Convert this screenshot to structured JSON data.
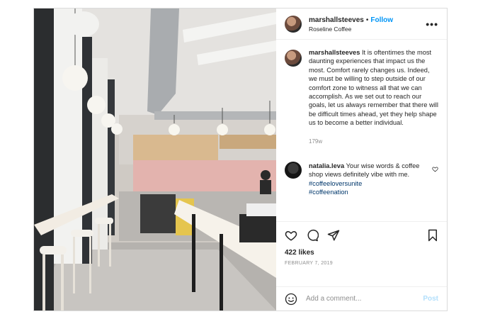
{
  "header": {
    "username": "marshallsteeves",
    "separator": "•",
    "follow_label": "Follow",
    "location": "Roseline Coffee",
    "more_icon": "more-horizontal-icon"
  },
  "caption": {
    "username": "marshallsteeves",
    "text": "It is oftentimes the most daunting experiences that impact us the most. Comfort rarely changes us. Indeed, we must be willing to step outside of our comfort zone to witness all that we can accomplish. As we set out to reach our goals, let us always remember that there will be difficult times ahead, yet they help shape us to become a better individual.",
    "time": "179w"
  },
  "comments": [
    {
      "username": "natalia.leva",
      "text": "Your wise words & coffee shop views definitely vibe with me.",
      "tags": [
        "#coffeeloversunite",
        "#coffeenation"
      ]
    }
  ],
  "actions": {
    "likes": "422 likes",
    "date": "FEBRUARY 7, 2019"
  },
  "add_comment": {
    "placeholder": "Add a comment...",
    "post_label": "Post"
  }
}
